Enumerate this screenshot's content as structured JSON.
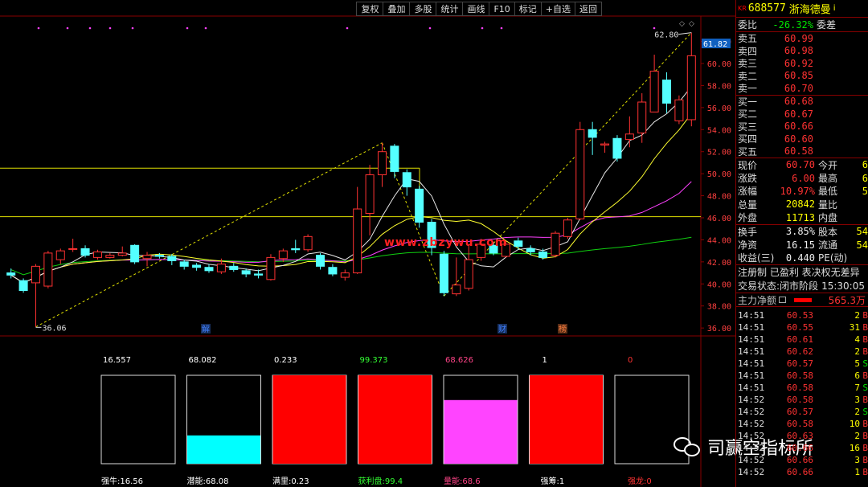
{
  "toolbar": [
    "复权",
    "叠加",
    "多股",
    "统计",
    "画线",
    "F10",
    "标记",
    "+自选",
    "返回"
  ],
  "stock": {
    "kr": "KR",
    "code": "688577",
    "name": "浙海德曼",
    "info_icon": "i"
  },
  "webi": {
    "label": "委比",
    "value": "-26.32%",
    "label2": "委差"
  },
  "asks": [
    {
      "label": "卖五",
      "price": "60.99"
    },
    {
      "label": "卖四",
      "price": "60.98"
    },
    {
      "label": "卖三",
      "price": "60.92"
    },
    {
      "label": "卖二",
      "price": "60.85"
    },
    {
      "label": "卖一",
      "price": "60.70"
    }
  ],
  "bids": [
    {
      "label": "买一",
      "price": "60.68"
    },
    {
      "label": "买二",
      "price": "60.67"
    },
    {
      "label": "买三",
      "price": "60.66"
    },
    {
      "label": "买四",
      "price": "60.60"
    },
    {
      "label": "买五",
      "price": "60.58"
    }
  ],
  "quote": [
    {
      "l1": "现价",
      "v1": "60.70",
      "c1": "red",
      "l2": "今开",
      "v2": "6"
    },
    {
      "l1": "涨跌",
      "v1": "6.00",
      "c1": "red",
      "l2": "最高",
      "v2": "6"
    },
    {
      "l1": "涨幅",
      "v1": "10.97%",
      "c1": "red",
      "l2": "最低",
      "v2": "5"
    },
    {
      "l1": "总量",
      "v1": "20842",
      "c1": "yellow",
      "l2": "量比",
      "v2": ""
    },
    {
      "l1": "外盘",
      "v1": "11713",
      "c1": "yellow",
      "l2": "内盘",
      "v2": ""
    }
  ],
  "fundamentals": [
    {
      "l1": "换手",
      "v1": "3.85%",
      "l2": "股本",
      "v2": "54"
    },
    {
      "l1": "净资",
      "v1": "16.15",
      "l2": "流通",
      "v2": "54"
    },
    {
      "l1": "收益(三)",
      "v1": "0.440",
      "l2": "PE(动)",
      "v2": ""
    }
  ],
  "status": {
    "line1": "注册制 已盈利 表决权无差异",
    "line2_label": "交易状态:",
    "line2_value": "闭市阶段",
    "line2_time": "15:30:05"
  },
  "main_flow": {
    "label": "主力净额",
    "value": "565.3万"
  },
  "ticks": [
    {
      "time": "14:51",
      "price": "60.53",
      "vol": "2",
      "bs": "B"
    },
    {
      "time": "14:51",
      "price": "60.55",
      "vol": "31",
      "bs": "B"
    },
    {
      "time": "14:51",
      "price": "60.61",
      "vol": "4",
      "bs": "B"
    },
    {
      "time": "14:51",
      "price": "60.62",
      "vol": "2",
      "bs": "B"
    },
    {
      "time": "14:51",
      "price": "60.57",
      "vol": "5",
      "bs": "S"
    },
    {
      "time": "14:51",
      "price": "60.58",
      "vol": "6",
      "bs": "B"
    },
    {
      "time": "14:51",
      "price": "60.58",
      "vol": "7",
      "bs": "S"
    },
    {
      "time": "14:52",
      "price": "60.58",
      "vol": "3",
      "bs": "B"
    },
    {
      "time": "14:52",
      "price": "60.57",
      "vol": "2",
      "bs": "S"
    },
    {
      "time": "14:52",
      "price": "60.58",
      "vol": "10",
      "bs": "B"
    },
    {
      "time": "14:52",
      "price": "60.63",
      "vol": "2",
      "bs": "B"
    },
    {
      "time": "14:52",
      "price": "60.66",
      "vol": "16",
      "bs": "B"
    },
    {
      "time": "14:52",
      "price": "60.66",
      "vol": "3",
      "bs": "B"
    },
    {
      "time": "14:52",
      "price": "60.66",
      "vol": "1",
      "bs": "B"
    }
  ],
  "watermark": {
    "text": "司赢空指标所",
    "center": "www.zbzywu.com"
  },
  "chart_data": [
    {
      "type": "candlestick",
      "y_axis_labels": [
        "62.00",
        "60.00",
        "58.00",
        "56.00",
        "54.00",
        "52.00",
        "50.00",
        "48.00",
        "46.00",
        "44.00",
        "42.00",
        "40.00",
        "38.00",
        "36.00"
      ],
      "ylim": [
        35.5,
        63.5
      ],
      "annotations": {
        "high": "62.80",
        "low": "36.06",
        "last_price_tag": "61.82"
      },
      "markers": [
        "解",
        "财",
        "榜"
      ],
      "candles": [
        [
          41.0,
          40.8,
          41.4,
          40.5
        ],
        [
          40.3,
          39.4,
          40.5,
          39.2
        ],
        [
          40.1,
          41.6,
          41.8,
          36.1
        ],
        [
          39.8,
          42.8,
          43.0,
          39.6
        ],
        [
          42.2,
          43.0,
          43.2,
          41.8
        ],
        [
          43.2,
          43.2,
          44.1,
          42.9
        ],
        [
          43.2,
          42.6,
          43.5,
          42.4
        ],
        [
          42.4,
          42.9,
          43.1,
          42.2
        ],
        [
          42.4,
          42.6,
          42.8,
          42.3
        ],
        [
          42.6,
          42.8,
          43.4,
          42.5
        ],
        [
          43.5,
          42.0,
          43.6,
          41.8
        ],
        [
          42.3,
          42.6,
          42.9,
          41.6
        ],
        [
          42.6,
          42.5,
          42.8,
          42.3
        ],
        [
          42.5,
          42.1,
          42.7,
          41.7
        ],
        [
          42.0,
          41.6,
          42.2,
          41.3
        ],
        [
          41.7,
          41.5,
          41.9,
          41.2
        ],
        [
          41.5,
          41.2,
          41.8,
          41.0
        ],
        [
          41.1,
          41.8,
          42.3,
          40.9
        ],
        [
          41.6,
          41.3,
          41.9,
          41.1
        ],
        [
          41.2,
          40.9,
          41.4,
          40.6
        ],
        [
          40.9,
          40.8,
          41.3,
          40.5
        ],
        [
          40.4,
          42.4,
          42.7,
          40.3
        ],
        [
          42.3,
          43.0,
          43.2,
          42.0
        ],
        [
          43.2,
          43.1,
          44.0,
          42.8
        ],
        [
          43.1,
          44.3,
          44.5,
          42.9
        ],
        [
          42.6,
          41.6,
          42.8,
          41.3
        ],
        [
          41.5,
          40.9,
          41.8,
          40.7
        ],
        [
          40.6,
          41.0,
          41.3,
          40.3
        ],
        [
          41.0,
          46.8,
          48.8,
          40.9
        ],
        [
          46.4,
          49.9,
          50.8,
          44.4
        ],
        [
          49.9,
          52.0,
          52.8,
          48.8
        ],
        [
          52.5,
          50.2,
          52.7,
          49.6
        ],
        [
          50.1,
          48.8,
          50.4,
          48.0
        ],
        [
          48.6,
          45.6,
          48.9,
          45.1
        ],
        [
          45.6,
          43.3,
          45.9,
          42.6
        ],
        [
          42.7,
          39.2,
          43.0,
          38.9
        ],
        [
          39.1,
          39.9,
          42.4,
          38.9
        ],
        [
          39.6,
          42.2,
          43.6,
          39.4
        ],
        [
          42.4,
          43.6,
          44.1,
          42.1
        ],
        [
          43.5,
          42.8,
          43.8,
          42.6
        ],
        [
          42.5,
          43.6,
          43.9,
          42.4
        ],
        [
          43.9,
          43.4,
          44.2,
          43.1
        ],
        [
          43.2,
          42.9,
          43.5,
          42.6
        ],
        [
          42.9,
          42.4,
          43.2,
          42.2
        ],
        [
          42.6,
          44.6,
          44.8,
          42.4
        ],
        [
          44.3,
          45.8,
          46.0,
          44.1
        ],
        [
          45.9,
          54.0,
          54.7,
          45.8
        ],
        [
          54.0,
          53.3,
          54.7,
          51.7
        ],
        [
          52.6,
          52.7,
          52.9,
          51.9
        ],
        [
          53.2,
          51.4,
          53.5,
          51.1
        ],
        [
          53.1,
          53.6,
          55.2,
          52.4
        ],
        [
          53.7,
          56.5,
          57.3,
          52.8
        ],
        [
          55.6,
          59.3,
          60.8,
          56.0
        ],
        [
          58.5,
          56.4,
          59.2,
          55.5
        ],
        [
          54.8,
          56.7,
          57.1,
          54.5
        ],
        [
          54.9,
          60.7,
          62.8,
          54.3
        ]
      ],
      "ma": [
        {
          "name": "MA5",
          "color": "#e8e8e8"
        },
        {
          "name": "MA10",
          "color": "#ffff30"
        },
        {
          "name": "MA20",
          "color": "#ff40ff"
        },
        {
          "name": "MA60",
          "color": "#10d010"
        }
      ],
      "horizontal_lines": [
        50.5,
        46.1
      ],
      "trend_lines": [
        [
          2,
          36.1,
          30,
          52.8
        ],
        [
          35,
          38.9,
          55,
          62.8
        ]
      ]
    },
    {
      "type": "bar",
      "categories": [
        "强牛",
        "潜能",
        "满里",
        "获利盘",
        "量能",
        "强筹",
        "强龙"
      ],
      "values": [
        16.557,
        68.082,
        0.233,
        99.373,
        68.626,
        1,
        0
      ],
      "value_labels": [
        "16.557",
        "68.082",
        "0.233",
        "99.373",
        "68.626",
        "1",
        "0"
      ],
      "footer_labels": [
        "强牛:16.56",
        "潜能:68.08",
        "满里:0.23",
        "获利盘:99.4",
        "量能:68.6",
        "强筹:1",
        "强龙:0"
      ],
      "fill_fraction": [
        0.0,
        0.32,
        1.0,
        1.0,
        0.72,
        1.0,
        0.0
      ],
      "fill_colors": [
        "#000000",
        "#00ffff",
        "#ff0000",
        "#ff0000",
        "#ff44ff",
        "#ff0000",
        "#000000"
      ],
      "label_colors": [
        "#ffffff",
        "#ffffff",
        "#ffffff",
        "#33ff33",
        "#ff4488",
        "#ffffff",
        "#ff3333"
      ]
    }
  ]
}
